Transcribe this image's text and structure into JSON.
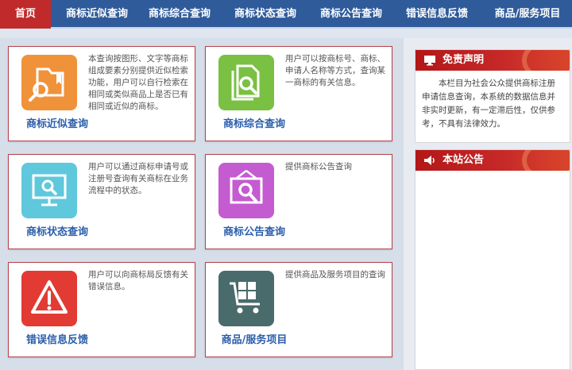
{
  "nav": [
    {
      "label": "首页",
      "active": true
    },
    {
      "label": "商标近似查询"
    },
    {
      "label": "商标综合查询"
    },
    {
      "label": "商标状态查询"
    },
    {
      "label": "商标公告查询"
    },
    {
      "label": "错误信息反馈"
    },
    {
      "label": "商品/服务项目"
    }
  ],
  "cards": [
    {
      "title": "商标近似查询",
      "desc": "本查询按图形、文字等商标组成要素分别提供近似检索功能，用户可以自行检索在相同或类似商品上是否已有相同或近似的商标。",
      "icon": "folder-search-icon",
      "color": "#f0923a"
    },
    {
      "title": "商标综合查询",
      "desc": "用户可以按商标号、商标、申请人名称等方式，查询某一商标的有关信息。",
      "icon": "document-search-icon",
      "color": "#7ac043"
    },
    {
      "title": "商标状态查询",
      "desc": "用户可以通过商标申请号或注册号查询有关商标在业务流程中的状态。",
      "icon": "monitor-search-icon",
      "color": "#5fc8dc"
    },
    {
      "title": "商标公告查询",
      "desc": "提供商标公告查询",
      "icon": "frame-search-icon",
      "color": "#c45bd0"
    },
    {
      "title": "错误信息反馈",
      "desc": "用户可以向商标局反馈有关错误信息。",
      "icon": "warning-icon",
      "color": "#e23b33"
    },
    {
      "title": "商品/服务项目",
      "desc": "提供商品及服务项目的查询",
      "icon": "cart-icon",
      "color": "#4a6b6b"
    }
  ],
  "sidebar": {
    "disclaimer": {
      "title": "免责声明",
      "body": "本栏目为社会公众提供商标注册申请信息查询，本系统的数据信息并非实时更新，有一定滞后性，仅供参考，不具有法律效力。"
    },
    "notice": {
      "title": "本站公告"
    }
  },
  "colors": {
    "nav": "#2f5b9a",
    "active": "#c12a2a",
    "card_border": "#b5434a",
    "title": "#2a5eaa"
  }
}
